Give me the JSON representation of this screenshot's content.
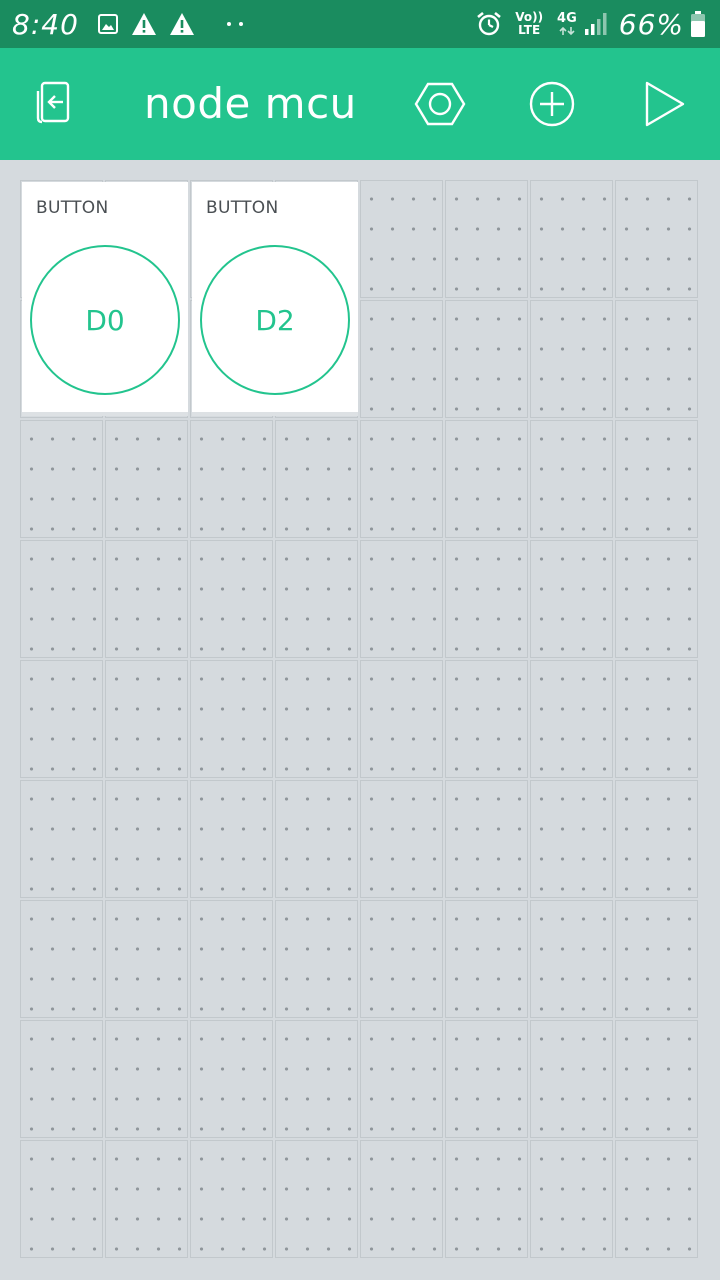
{
  "status_bar": {
    "time": "8:40",
    "volte_top": "Vo))",
    "volte_bottom": "LTE",
    "network": "4G",
    "battery": "66%",
    "icons": [
      "image-icon",
      "warning-icon",
      "warning-icon",
      "more-dots-icon",
      "alarm-icon",
      "signal-icon",
      "battery-icon"
    ]
  },
  "app_bar": {
    "title": "node mcu",
    "icons": [
      "exit-icon",
      "settings-hex-icon",
      "add-widget-icon",
      "play-icon"
    ]
  },
  "widgets": [
    {
      "label": "BUTTON",
      "pin": "D0"
    },
    {
      "label": "BUTTON",
      "pin": "D2"
    }
  ],
  "colors": {
    "status_bar": "#1a8c5f",
    "app_bar": "#23c48e",
    "accent": "#23c48e",
    "canvas": "#d5dade",
    "widget_bg": "#ffffff"
  }
}
